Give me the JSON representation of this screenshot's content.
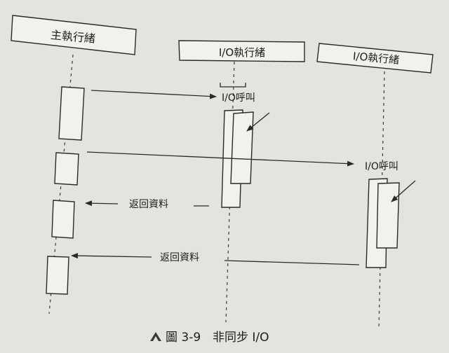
{
  "participants": {
    "main": "主執行緒",
    "io1": "I/O執行緒",
    "io2": "I/O執行緒"
  },
  "messages": {
    "call1": "I/O呼叫",
    "call2": "I/O呼叫",
    "return1": "返回資料",
    "return2": "返回資料"
  },
  "caption": {
    "label": "圖 3-9",
    "title": "非同步 I/O"
  },
  "icons": {
    "caption_marker": "triangle-a-icon"
  }
}
